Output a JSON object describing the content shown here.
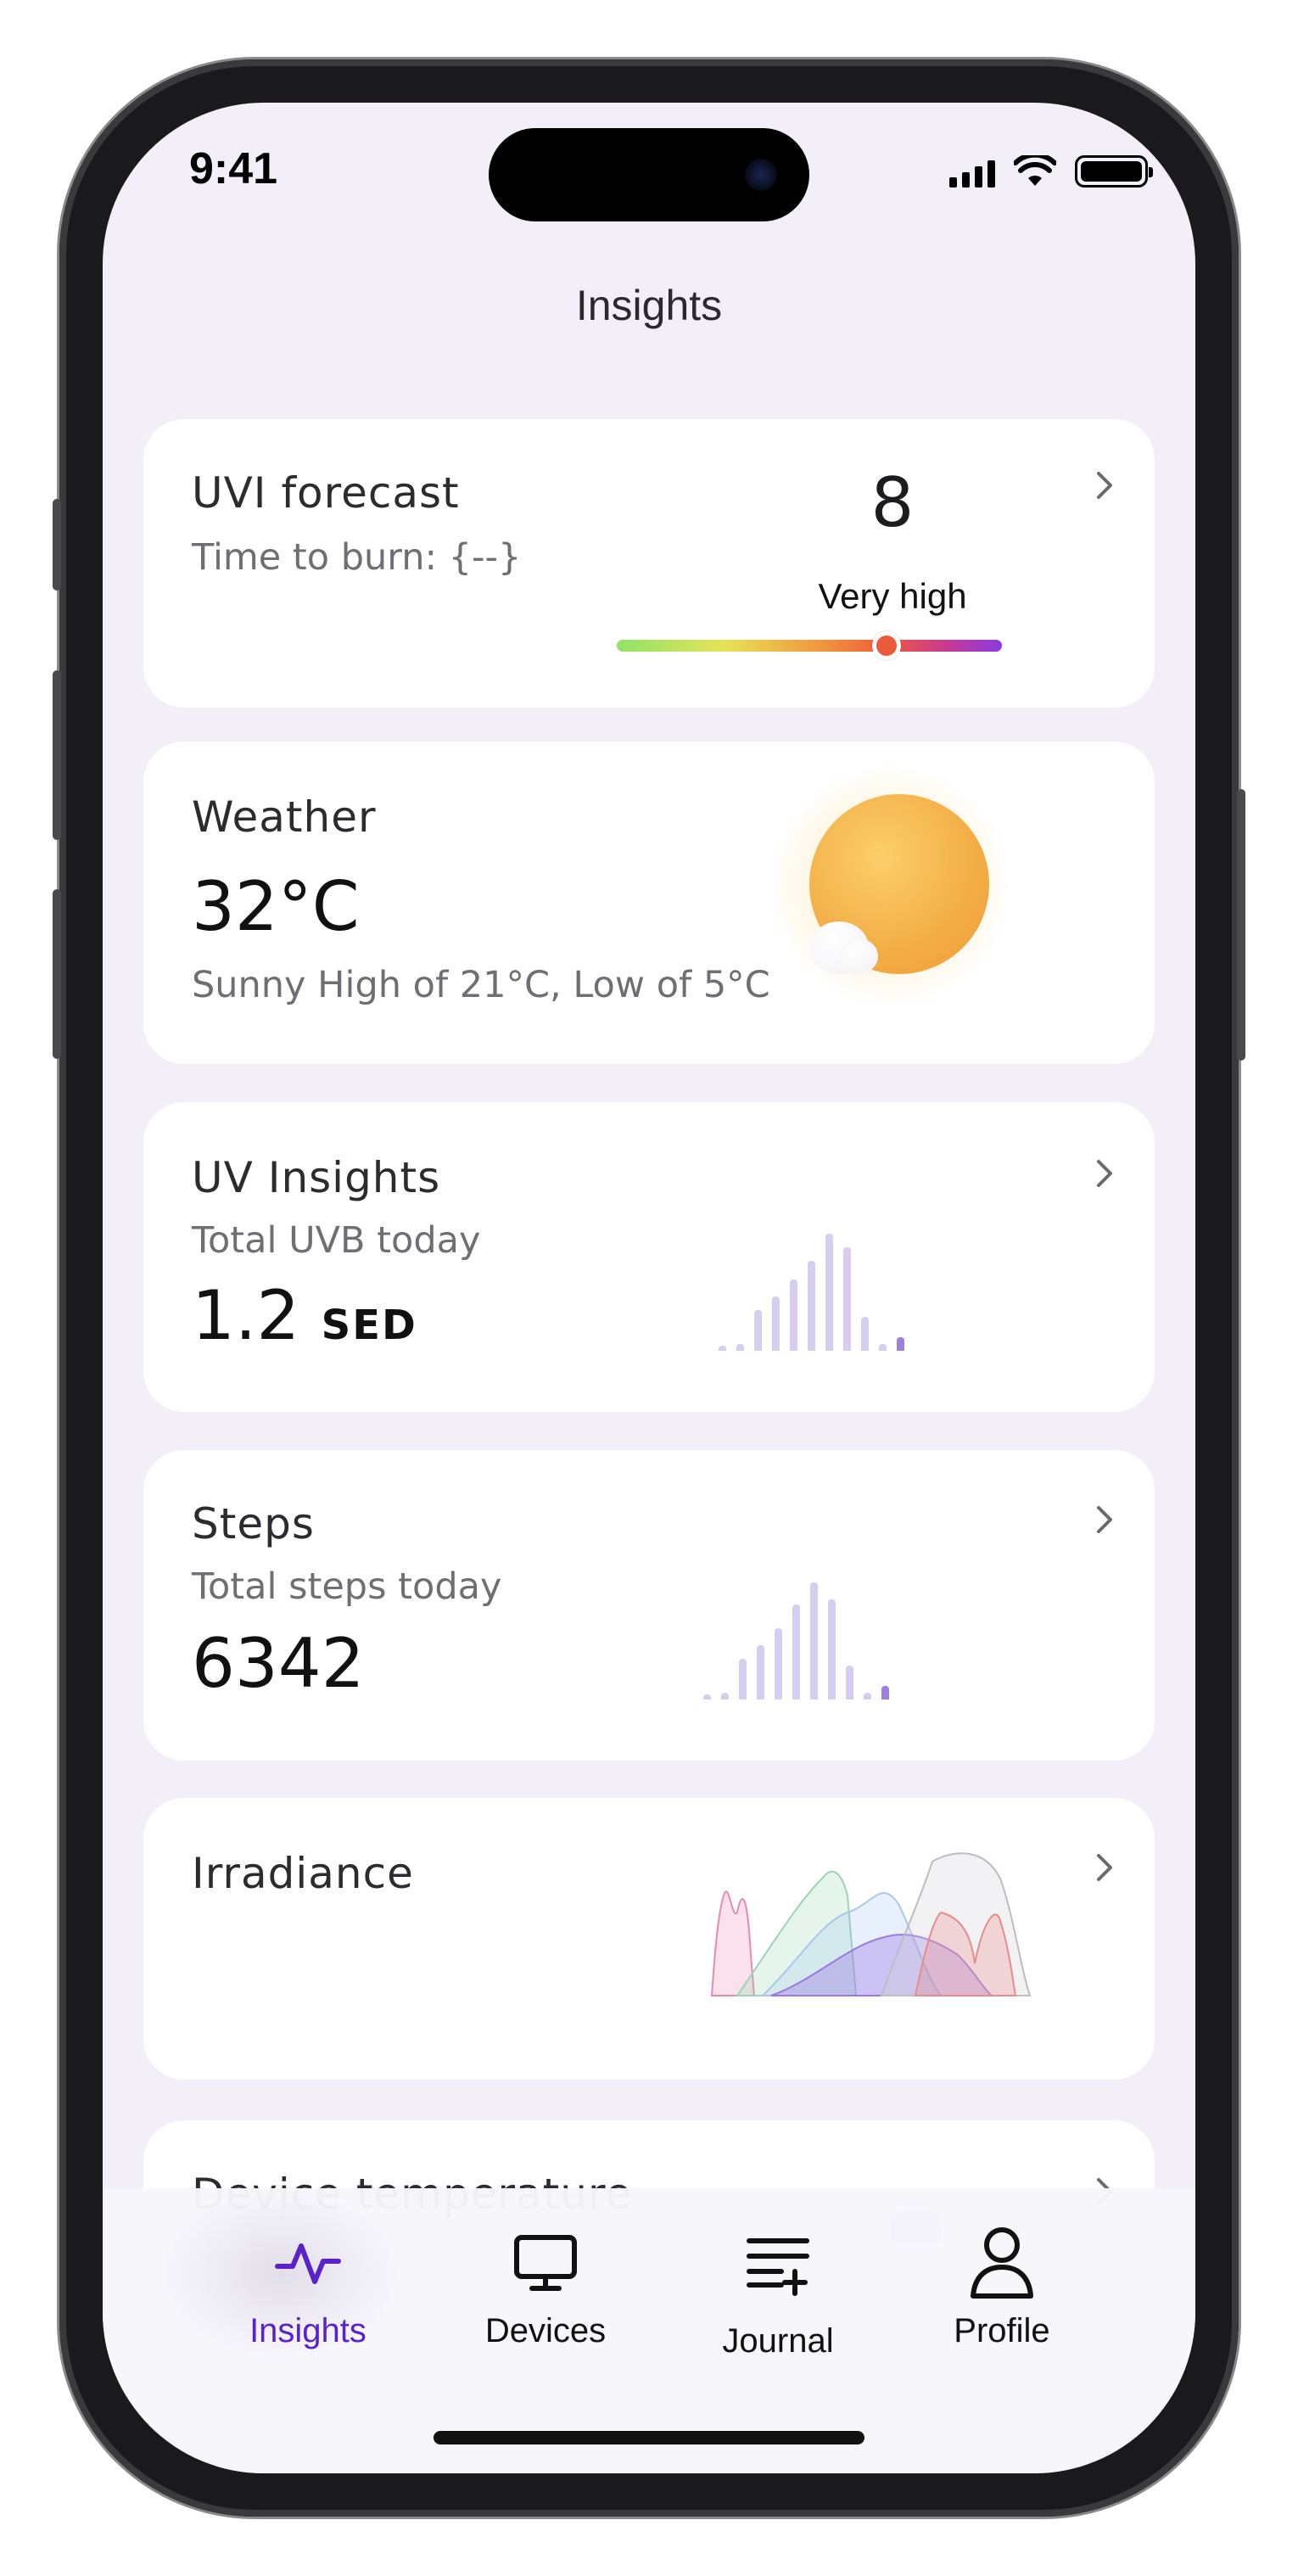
{
  "status_bar": {
    "time": "9:41"
  },
  "header": {
    "title": "Insights"
  },
  "uvi_card": {
    "title": "UVI forecast",
    "subtitle": "Time to burn: {--}",
    "value": "8",
    "level_label": "Very high",
    "level_fraction": 0.7
  },
  "weather_card": {
    "title": "Weather",
    "temperature": "32°C",
    "summary": "Sunny High of 21°C, Low of 5°C",
    "icon": "sun-with-cloud-icon"
  },
  "uv_insights_card": {
    "title": "UV Insights",
    "subtitle": "Total UVB today",
    "value": "1.2",
    "unit": "SED"
  },
  "steps_card": {
    "title": "Steps",
    "subtitle": "Total steps today",
    "value": "6342"
  },
  "irradiance_card": {
    "title": "Irradiance"
  },
  "device_temp_card": {
    "title": "Device temperature"
  },
  "tab_bar": {
    "items": [
      {
        "label": "Insights",
        "icon": "activity-pulse-icon",
        "active": true
      },
      {
        "label": "Devices",
        "icon": "monitor-icon",
        "active": false
      },
      {
        "label": "Journal",
        "icon": "add-list-icon",
        "active": false
      },
      {
        "label": "Profile",
        "icon": "person-icon",
        "active": false
      }
    ]
  },
  "colors": {
    "accent": "#5a22c9",
    "background": "#f2eff8",
    "card": "#ffffff",
    "bar_light": "#d7cdef",
    "bar_accent": "#a07fdc"
  }
}
